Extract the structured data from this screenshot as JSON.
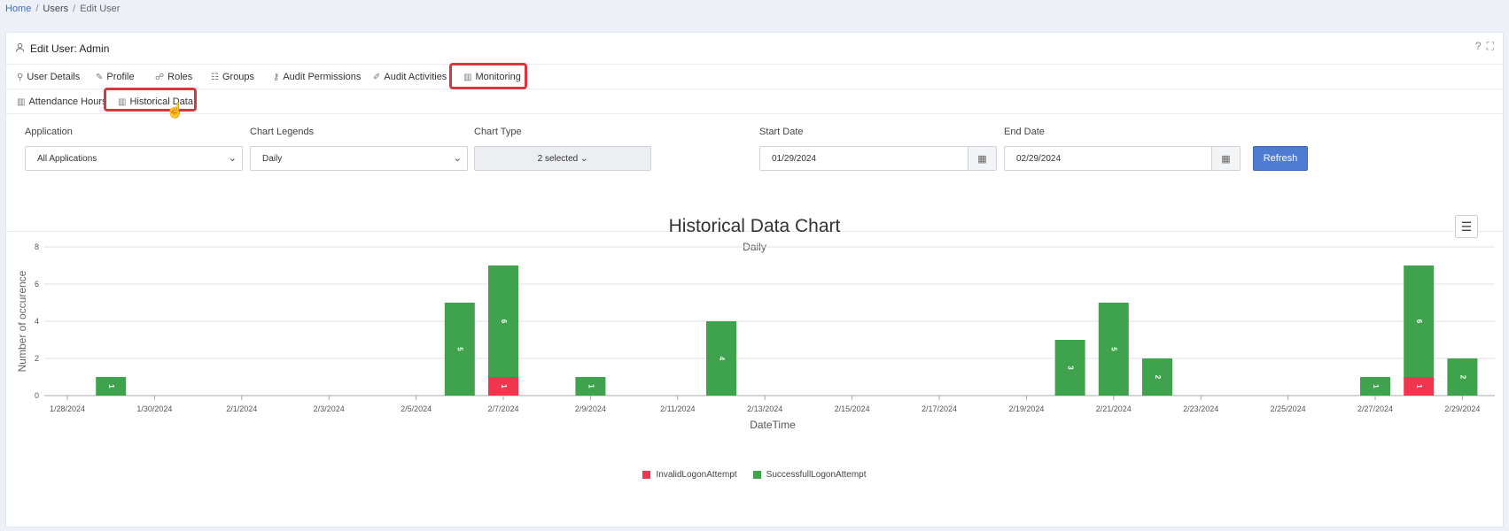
{
  "breadcrumb": {
    "home": "Home",
    "users": "Users",
    "current": "Edit User",
    "sep": "/"
  },
  "header": {
    "title": "Edit User: Admin",
    "help_icon": "?",
    "expand_icon": "⛶"
  },
  "tabs": [
    {
      "label": "User Details",
      "icon": "user-icon"
    },
    {
      "label": "Profile",
      "icon": "profile-icon"
    },
    {
      "label": "Roles",
      "icon": "roles-icon"
    },
    {
      "label": "Groups",
      "icon": "groups-icon"
    },
    {
      "label": "Audit Permissions",
      "icon": "key-icon"
    },
    {
      "label": "Audit Activities",
      "icon": "edit-icon"
    },
    {
      "label": "Monitoring",
      "icon": "chart-icon",
      "active": true
    }
  ],
  "subtabs": [
    {
      "label": "Attendance Hours",
      "icon": "chart-icon"
    },
    {
      "label": "Historical Data",
      "icon": "chart-icon",
      "active": true
    }
  ],
  "filters": {
    "application": {
      "label": "Application",
      "value": "All Applications"
    },
    "chart_legends": {
      "label": "Chart Legends",
      "value": "Daily"
    },
    "chart_type": {
      "label": "Chart Type",
      "value": "2 selected ⌄"
    },
    "start_date": {
      "label": "Start Date",
      "value": "01/29/2024"
    },
    "end_date": {
      "label": "End Date",
      "value": "02/29/2024"
    },
    "refresh_label": "Refresh"
  },
  "colors": {
    "success": "#3fa34d",
    "invalid": "#f0354f",
    "accent": "#4f7bd2",
    "highlight": "#d9363e"
  },
  "chart_data": {
    "type": "bar",
    "stacked": true,
    "title": "Historical Data Chart",
    "subtitle": "Daily",
    "xlabel": "DateTime",
    "ylabel": "Number of occurence",
    "ylim": [
      0,
      8
    ],
    "yticks": [
      0,
      2,
      4,
      6,
      8
    ],
    "grid": true,
    "legend_position": "bottom",
    "x_tick_labels": [
      "1/28/2024",
      "1/30/2024",
      "2/1/2024",
      "2/3/2024",
      "2/5/2024",
      "2/7/2024",
      "2/9/2024",
      "2/11/2024",
      "2/13/2024",
      "2/15/2024",
      "2/17/2024",
      "2/19/2024",
      "2/21/2024",
      "2/23/2024",
      "2/25/2024",
      "2/27/2024",
      "2/29/2024"
    ],
    "categories": [
      "1/29/2024",
      "2/6/2024",
      "2/7/2024",
      "2/9/2024",
      "2/12/2024",
      "2/20/2024",
      "2/21/2024",
      "2/22/2024",
      "2/27/2024",
      "2/28/2024",
      "2/29/2024"
    ],
    "series": [
      {
        "name": "InvalidLogonAttempt",
        "color": "#f0354f",
        "values": [
          0,
          0,
          1,
          0,
          0,
          0,
          0,
          0,
          0,
          1,
          0
        ]
      },
      {
        "name": "SuccessfullLogonAttempt",
        "color": "#3fa34d",
        "values": [
          1,
          5,
          6,
          1,
          4,
          3,
          5,
          2,
          1,
          6,
          2
        ]
      }
    ]
  }
}
